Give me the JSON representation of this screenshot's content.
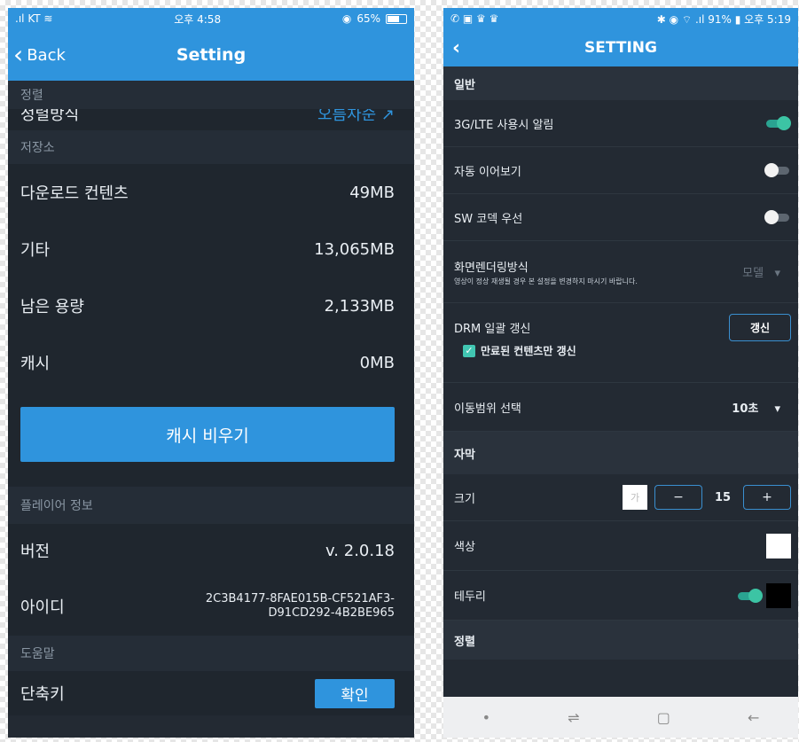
{
  "ios": {
    "status": {
      "carrier": "KT",
      "time": "오후 4:58",
      "battery": "65%",
      "battery_level": 0.65
    },
    "nav": {
      "back_label": "Back",
      "title": "Setting"
    },
    "sort_section": "정렬",
    "sort_row": {
      "label": "정렬방식",
      "value": "오름차순 ↗"
    },
    "storage_section": "저장소",
    "storage": [
      {
        "label": "다운로드 컨텐츠",
        "value": "49MB"
      },
      {
        "label": "기타",
        "value": "13,065MB"
      },
      {
        "label": "남은 용량",
        "value": "2,133MB"
      },
      {
        "label": "캐시",
        "value": "0MB"
      }
    ],
    "clear_cache_label": "캐시 비우기",
    "player_section": "플레이어 정보",
    "version": {
      "label": "버전",
      "value": "v. 2.0.18"
    },
    "id": {
      "label": "아이디",
      "line1": "2C3B4177-8FAE015B-CF521AF3-",
      "line2": "D91CD292-4B2BE965"
    },
    "help_section": "도움말",
    "shortcut": {
      "label": "단축키",
      "button": "확인"
    }
  },
  "android": {
    "status": {
      "left": "✆ ▣ ♛ ♛",
      "right": "✱ ◉ ⌔ .ıl 91% ▮ 오후 5:19"
    },
    "nav": {
      "back": "‹",
      "title": "SETTING"
    },
    "general_section": "일반",
    "lte_alert": {
      "label": "3G/LTE 사용시 알림",
      "on": true
    },
    "auto_continue": {
      "label": "자동 이어보기",
      "on": false
    },
    "sw_codec": {
      "label": "SW 코덱 우선",
      "on": false
    },
    "render": {
      "label": "화면렌더링방식",
      "desc": "영상이 정상 재생될 경우 본 설정을 변경하지 마시기 바랍니다.",
      "value": "모델",
      "arrow": "▾"
    },
    "drm": {
      "label": "DRM 일괄 갱신",
      "button": "갱신",
      "check_label": "만료된 컨텐츠만 갱신",
      "checked": true
    },
    "seek_range": {
      "label": "이동범위 선택",
      "value": "10초",
      "arrow": "▾"
    },
    "subtitle_section": "자막",
    "size": {
      "label": "크기",
      "preview": "가",
      "minus": "−",
      "value": "15",
      "plus": "+"
    },
    "color": {
      "label": "색상",
      "swatch": "#ffffff"
    },
    "border": {
      "label": "테두리",
      "on": true,
      "swatch": "#000000"
    },
    "sort_section": "정렬",
    "bottom_nav": {
      "dot": "•",
      "recent": "⇌",
      "home": "▢",
      "back": "←"
    }
  }
}
